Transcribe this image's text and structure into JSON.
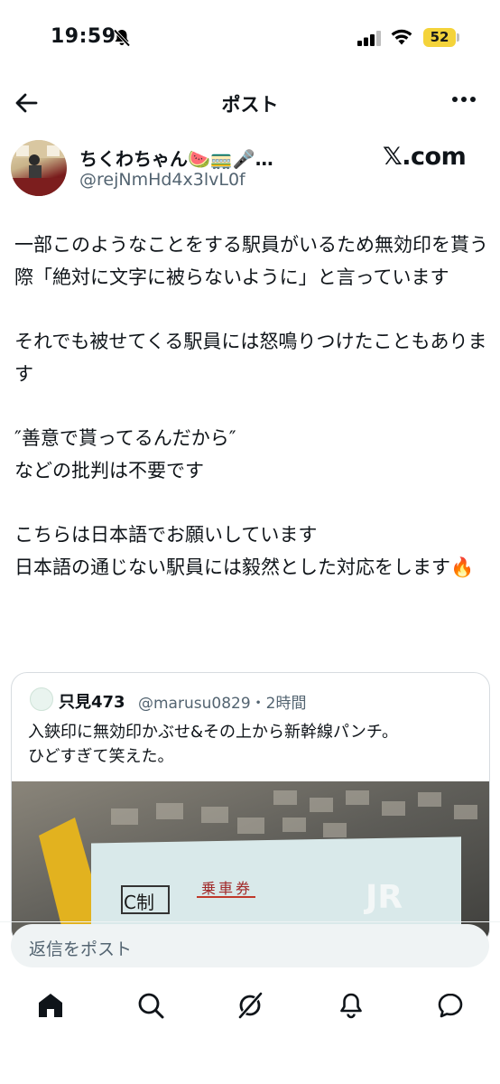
{
  "status_bar": {
    "time": "19:59",
    "battery": "52"
  },
  "nav": {
    "title": "ポスト"
  },
  "author": {
    "display_name": "ちくわちゃん🍉🚃🎤…",
    "handle": "@rejNmHd4x3lvL0f",
    "brand": "𝕏.com"
  },
  "post": {
    "paragraphs": [
      "一部このようなことをする駅員がいるため無効印を貰う際「絶対に文字に被らないように」と言っています",
      "それでも被せてくる駅員には怒鳴りつけたこともあります",
      "″善意で貰ってるんだから″\nなどの批判は不要です",
      "こちらは日本語でお願いしています\n日本語の通じない駅員には毅然とした対応をします🔥"
    ]
  },
  "quote": {
    "name": "只見473",
    "handle_time": "@marusu0829・2時間",
    "text": "入鋏印に無効印かぶせ&その上から新幹線パンチ。\nひどすぎて笑えた。",
    "image_texts": {
      "stamp": "C制",
      "ticket_label": "乗車券",
      "jr": "JR"
    }
  },
  "reply": {
    "placeholder": "返信をポスト"
  },
  "tabs": [
    "home",
    "search",
    "grok",
    "notifications",
    "messages"
  ],
  "colors": {
    "text": "#0f1419",
    "secondary": "#536471",
    "battery": "#f4d33a",
    "border": "#d7dce0"
  }
}
